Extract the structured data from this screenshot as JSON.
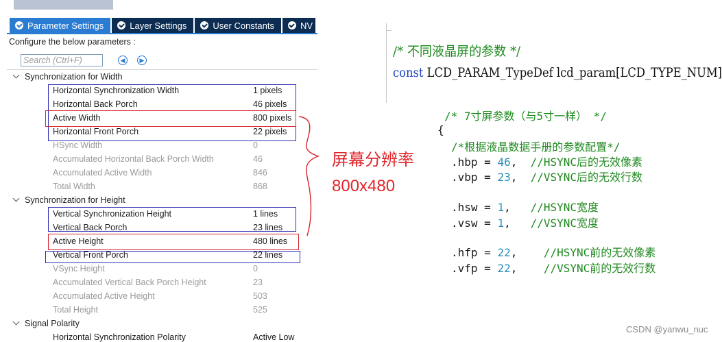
{
  "tabs": [
    {
      "label": "Parameter Settings"
    },
    {
      "label": "Layer Settings"
    },
    {
      "label": "User Constants"
    },
    {
      "label": "NV"
    }
  ],
  "configure_label": "Configure the below parameters :",
  "search": {
    "placeholder": "Search (Ctrl+F)"
  },
  "groups": [
    {
      "label": "Synchronization for Width"
    },
    {
      "label": "Synchronization for Height"
    },
    {
      "label": "Signal Polarity"
    }
  ],
  "width_params": [
    {
      "name": "Horizontal Synchronization Width",
      "value": "1 pixels"
    },
    {
      "name": "Horizontal Back Porch",
      "value": "46 pixels"
    },
    {
      "name": "Active Width",
      "value": "800 pixels"
    },
    {
      "name": "Horizontal Front Porch",
      "value": "22 pixels"
    },
    {
      "name": "HSync Width",
      "value": "0"
    },
    {
      "name": "Accumulated Horizontal Back Porch Width",
      "value": "46"
    },
    {
      "name": "Accumulated Active Width",
      "value": "846"
    },
    {
      "name": "Total Width",
      "value": "868"
    }
  ],
  "height_params": [
    {
      "name": "Vertical Synchronization Height",
      "value": "1 lines"
    },
    {
      "name": "Vertical Back Porch",
      "value": "23 lines"
    },
    {
      "name": "Active Height",
      "value": "480 lines"
    },
    {
      "name": "Vertical Front Porch",
      "value": "22 lines"
    },
    {
      "name": "VSync Height",
      "value": "0"
    },
    {
      "name": "Accumulated Vertical Back Porch Height",
      "value": "23"
    },
    {
      "name": "Accumulated Active Height",
      "value": "503"
    },
    {
      "name": "Total Height",
      "value": "525"
    }
  ],
  "polarity_params": [
    {
      "name": "Horizontal Synchronization Polarity",
      "value": "Active Low"
    }
  ],
  "annotation": {
    "text": "屏幕分辨率",
    "resolution": "800x480"
  },
  "code_top": {
    "comment": "/* 不同液晶屏的参数 */",
    "keyword": "const",
    "declaration": " LCD_PARAM_TypeDef lcd_param[LCD_TYPE_NUM]={"
  },
  "code_block": {
    "comment_title": "/* 7寸屏参数（与5寸一样） */",
    "open_brace": "{",
    "comment_config": "/*根据液晶数据手册的参数配置*/",
    "fields": [
      {
        "name": ".hbp = ",
        "value": "46",
        "sep": ",  ",
        "comment": "//HSYNC后的无效像素"
      },
      {
        "name": ".vbp = ",
        "value": "23",
        "sep": ",  ",
        "comment": "//VSYNC后的无效行数"
      },
      {
        "name": ".hsw = ",
        "value": "1",
        "sep": ",   ",
        "comment": "//HSYNC宽度"
      },
      {
        "name": ".vsw = ",
        "value": "1",
        "sep": ",   ",
        "comment": "//VSYNC宽度"
      },
      {
        "name": ".hfp = ",
        "value": "22",
        "sep": ",    ",
        "comment": "//HSYNC前的无效像素"
      },
      {
        "name": ".vfp = ",
        "value": "22",
        "sep": ",    ",
        "comment": "//VSYNC前的无效行数"
      }
    ]
  },
  "watermark": "CSDN @yanwu_nuc",
  "colors": {
    "tab_active": "#2a7bd2",
    "tab": "#0c2c52",
    "highlight_red": "#d8232a",
    "highlight_blue": "#2b2bb5",
    "code_comment": "#1f8a1f",
    "code_keyword": "#1c3fbf",
    "code_number": "#2a8fb7"
  }
}
